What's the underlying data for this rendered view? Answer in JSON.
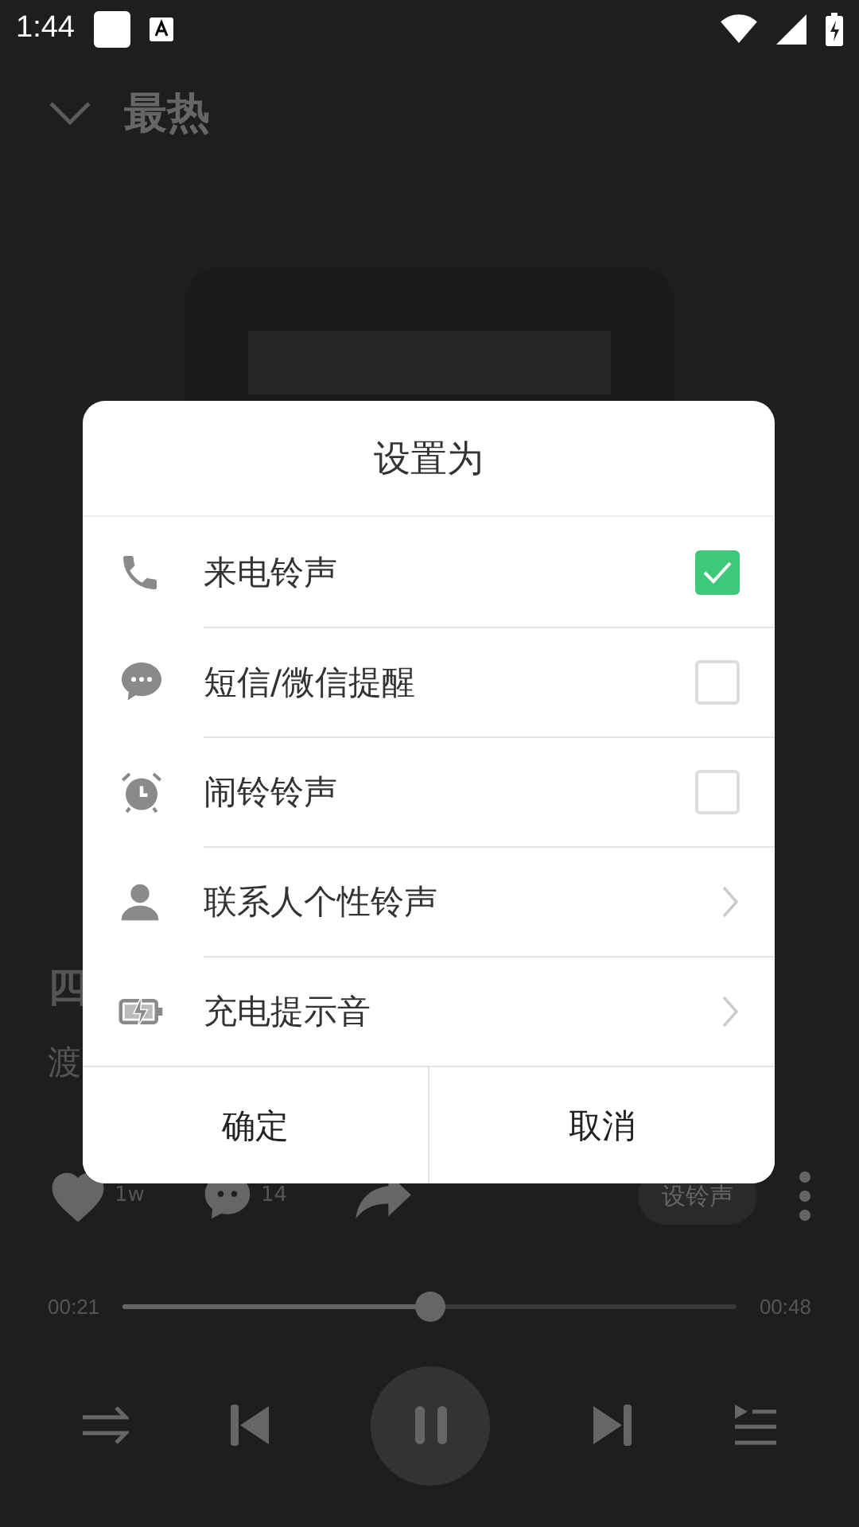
{
  "status_bar": {
    "time": "1:44"
  },
  "header": {
    "title": "最热"
  },
  "song": {
    "title": "四",
    "artist": "渡"
  },
  "actions": {
    "likes": "1w",
    "comments": "14",
    "ringtone_button": "设铃声"
  },
  "progress": {
    "elapsed": "00:21",
    "total": "00:48",
    "level": 0.5
  },
  "dialog": {
    "title": "设置为",
    "options": [
      {
        "kind": "checkbox",
        "label": "来电铃声",
        "checked": true
      },
      {
        "kind": "checkbox",
        "label": "短信/微信提醒",
        "checked": false
      },
      {
        "kind": "checkbox",
        "label": "闹铃铃声",
        "checked": false
      },
      {
        "kind": "link",
        "label": "联系人个性铃声"
      },
      {
        "kind": "link",
        "label": "充电提示音"
      }
    ],
    "buttons": [
      "确定",
      "取消"
    ]
  }
}
